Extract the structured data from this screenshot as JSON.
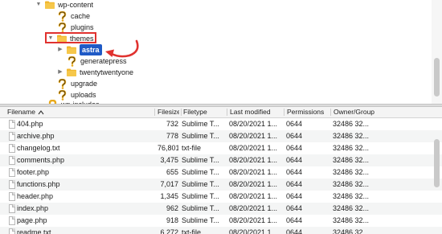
{
  "tree": {
    "items": [
      {
        "label": "wp-content",
        "icon": "folder-icon",
        "expanded": true
      },
      {
        "label": "cache",
        "icon": "unknown-folder-icon"
      },
      {
        "label": "plugins",
        "icon": "unknown-folder-icon"
      },
      {
        "label": "themes",
        "icon": "folder-icon",
        "expanded": true
      },
      {
        "label": "astra",
        "icon": "folder-icon",
        "selected": true
      },
      {
        "label": "generatepress",
        "icon": "unknown-folder-icon"
      },
      {
        "label": "twentytwentyone",
        "icon": "folder-icon"
      },
      {
        "label": "upgrade",
        "icon": "unknown-folder-icon"
      },
      {
        "label": "uploads",
        "icon": "unknown-folder-icon"
      },
      {
        "label": "wp-includes",
        "icon": "unknown-folder-icon"
      }
    ]
  },
  "colors": {
    "highlight_box": "#e0322f",
    "selection": "#1f5ac6",
    "folder": "#f1b72e"
  },
  "file_list": {
    "columns": {
      "filename": "Filename",
      "filesize": "Filesize",
      "filetype": "Filetype",
      "last_modified": "Last modified",
      "permissions": "Permissions",
      "owner_group": "Owner/Group"
    },
    "files": [
      {
        "name": "404.php",
        "size": "732",
        "type": "Sublime T...",
        "modified": "08/20/2021 1...",
        "perms": "0644",
        "owner": "32486 32..."
      },
      {
        "name": "archive.php",
        "size": "778",
        "type": "Sublime T...",
        "modified": "08/20/2021 1...",
        "perms": "0644",
        "owner": "32486 32..."
      },
      {
        "name": "changelog.txt",
        "size": "76,801",
        "type": "txt-file",
        "modified": "08/20/2021 1...",
        "perms": "0644",
        "owner": "32486 32..."
      },
      {
        "name": "comments.php",
        "size": "3,475",
        "type": "Sublime T...",
        "modified": "08/20/2021 1...",
        "perms": "0644",
        "owner": "32486 32..."
      },
      {
        "name": "footer.php",
        "size": "655",
        "type": "Sublime T...",
        "modified": "08/20/2021 1...",
        "perms": "0644",
        "owner": "32486 32..."
      },
      {
        "name": "functions.php",
        "size": "7,017",
        "type": "Sublime T...",
        "modified": "08/20/2021 1...",
        "perms": "0644",
        "owner": "32486 32..."
      },
      {
        "name": "header.php",
        "size": "1,345",
        "type": "Sublime T...",
        "modified": "08/20/2021 1...",
        "perms": "0644",
        "owner": "32486 32..."
      },
      {
        "name": "index.php",
        "size": "962",
        "type": "Sublime T...",
        "modified": "08/20/2021 1...",
        "perms": "0644",
        "owner": "32486 32..."
      },
      {
        "name": "page.php",
        "size": "918",
        "type": "Sublime T...",
        "modified": "08/20/2021 1...",
        "perms": "0644",
        "owner": "32486 32..."
      },
      {
        "name": "readme.txt",
        "size": "6,272",
        "type": "txt-file",
        "modified": "08/20/2021 1...",
        "perms": "0644",
        "owner": "32486 32..."
      }
    ]
  }
}
